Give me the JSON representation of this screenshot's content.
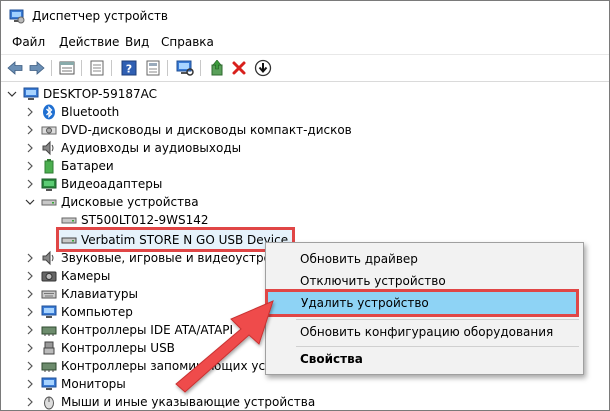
{
  "window": {
    "title": "Диспетчер устройств"
  },
  "menu": [
    "Файл",
    "Действие",
    "Вид",
    "Справка"
  ],
  "toolbar": [
    {
      "name": "back-arrow-icon"
    },
    {
      "name": "forward-arrow-icon"
    },
    {
      "name": "properties-icon"
    },
    {
      "name": "list-view-icon"
    },
    {
      "name": "help-icon"
    },
    {
      "name": "device-view-icon"
    },
    {
      "name": "scan-hardware-icon"
    },
    {
      "name": "update-driver-icon"
    },
    {
      "name": "uninstall-device-icon"
    },
    {
      "name": "download-driver-icon"
    }
  ],
  "tree": {
    "root": "DESKTOP-59187AC",
    "items": [
      "Bluetooth",
      "DVD-дисководы и дисководы компакт-дисков",
      "Аудиовходы и аудиовыходы",
      "Батареи",
      "Видеоадаптеры",
      "Дисковые устройства",
      "ST500LT012-9WS142",
      "Verbatim STORE N GO USB Device",
      "Звуковые, игровые и видеоустройства",
      "Камеры",
      "Клавиатуры",
      "Компьютер",
      "Контроллеры IDE ATA/ATAPI",
      "Контроллеры USB",
      "Контроллеры запоминающих устройств",
      "Мониторы",
      "Мыши и иные указывающие устройства"
    ]
  },
  "context_menu": {
    "items": [
      "Обновить драйвер",
      "Отключить устройство",
      "Удалить устройство",
      "Обновить конфигурацию оборудования",
      "Свойства"
    ]
  },
  "colors": {
    "highlight": "#8ed3f5",
    "callout": "#e04646",
    "selection": "#e6f2fb"
  }
}
